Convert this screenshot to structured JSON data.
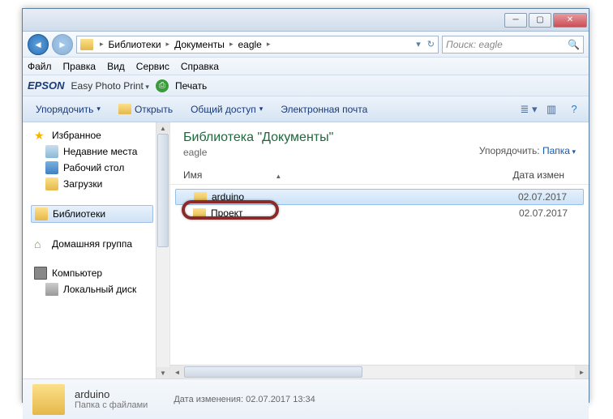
{
  "breadcrumb": {
    "p1": "Библиотеки",
    "p2": "Документы",
    "p3": "eagle"
  },
  "search": {
    "placeholder": "Поиск: eagle"
  },
  "menu": {
    "file": "Файл",
    "edit": "Правка",
    "view": "Вид",
    "service": "Сервис",
    "help": "Справка"
  },
  "epson": {
    "logo": "EPSON",
    "easy": "Easy Photo Print",
    "print": "Печать"
  },
  "toolbar": {
    "organize": "Упорядочить",
    "open": "Открыть",
    "share": "Общий доступ",
    "email": "Электронная почта"
  },
  "sidebar": {
    "favorites": "Избранное",
    "recent": "Недавние места",
    "desktop": "Рабочий стол",
    "downloads": "Загрузки",
    "libraries": "Библиотеки",
    "homegroup": "Домашняя группа",
    "computer": "Компьютер",
    "localdisk": "Локальный диск"
  },
  "header": {
    "title": "Библиотека \"Документы\"",
    "subtitle": "eagle",
    "arrange_label": "Упорядочить:",
    "arrange_value": "Папка"
  },
  "columns": {
    "name": "Имя",
    "date": "Дата измен"
  },
  "files": [
    {
      "name": "arduino",
      "date": "02.07.2017"
    },
    {
      "name": "Проект",
      "date": "02.07.2017"
    }
  ],
  "details": {
    "name": "arduino",
    "type": "Папка с файлами",
    "date_label": "Дата изменения:",
    "date_value": "02.07.2017 13:34"
  }
}
